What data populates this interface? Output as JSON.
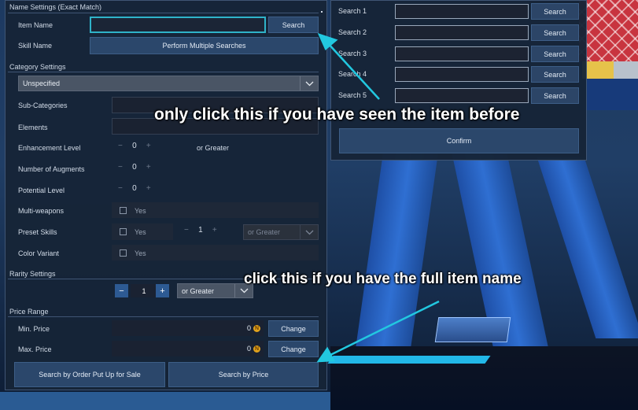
{
  "name_settings": {
    "title": "Name Settings (Exact Match)",
    "item_name_label": "Item Name",
    "item_name_value": "",
    "search_button": "Search",
    "skill_name_label": "Skill Name",
    "multi_search_button": "Perform Multiple Searches"
  },
  "category_settings": {
    "title": "Category Settings",
    "category_select": "Unspecified",
    "sub_categories_label": "Sub-Categories",
    "elements_label": "Elements",
    "enhancement_label": "Enhancement Level",
    "enhancement_value": "0",
    "or_greater": "or Greater",
    "augments_label": "Number of Augments",
    "augments_value": "0",
    "potential_label": "Potential Level",
    "potential_value": "0",
    "multi_weapons_label": "Multi-weapons",
    "multi_weapons_yes": "Yes",
    "preset_skills_label": "Preset Skills",
    "preset_skills_yes": "Yes",
    "preset_skills_value": "1",
    "preset_skills_select": "or Greater",
    "color_variant_label": "Color Variant",
    "color_variant_yes": "Yes",
    "minus": "−",
    "plus": "+"
  },
  "rarity_settings": {
    "title": "Rarity Settings",
    "value": "1",
    "select": "or Greater",
    "minus": "−",
    "plus": "+"
  },
  "price_range": {
    "title": "Price Range",
    "min_label": "Min. Price",
    "min_value": "0",
    "max_label": "Max. Price",
    "max_value": "0",
    "change_button": "Change",
    "coin_symbol": "N"
  },
  "bottom_buttons": {
    "order_sale": "Search by Order Put Up for Sale",
    "by_price": "Search by Price"
  },
  "multi_search": {
    "rows": [
      {
        "label": "Search 1",
        "button": "Search"
      },
      {
        "label": "Search 2",
        "button": "Search"
      },
      {
        "label": "Search 3",
        "button": "Search"
      },
      {
        "label": "Search 4",
        "button": "Search"
      },
      {
        "label": "Search 5",
        "button": "Search"
      }
    ],
    "confirm": "Confirm"
  },
  "annotations": {
    "top": "only click this if you have seen the item before",
    "bottom": "click this if you have the full item name",
    "arrow_color": "#22c8e0"
  },
  "icons": {
    "chevron": "chevron-down-icon",
    "coin": "meseta-coin-icon"
  }
}
